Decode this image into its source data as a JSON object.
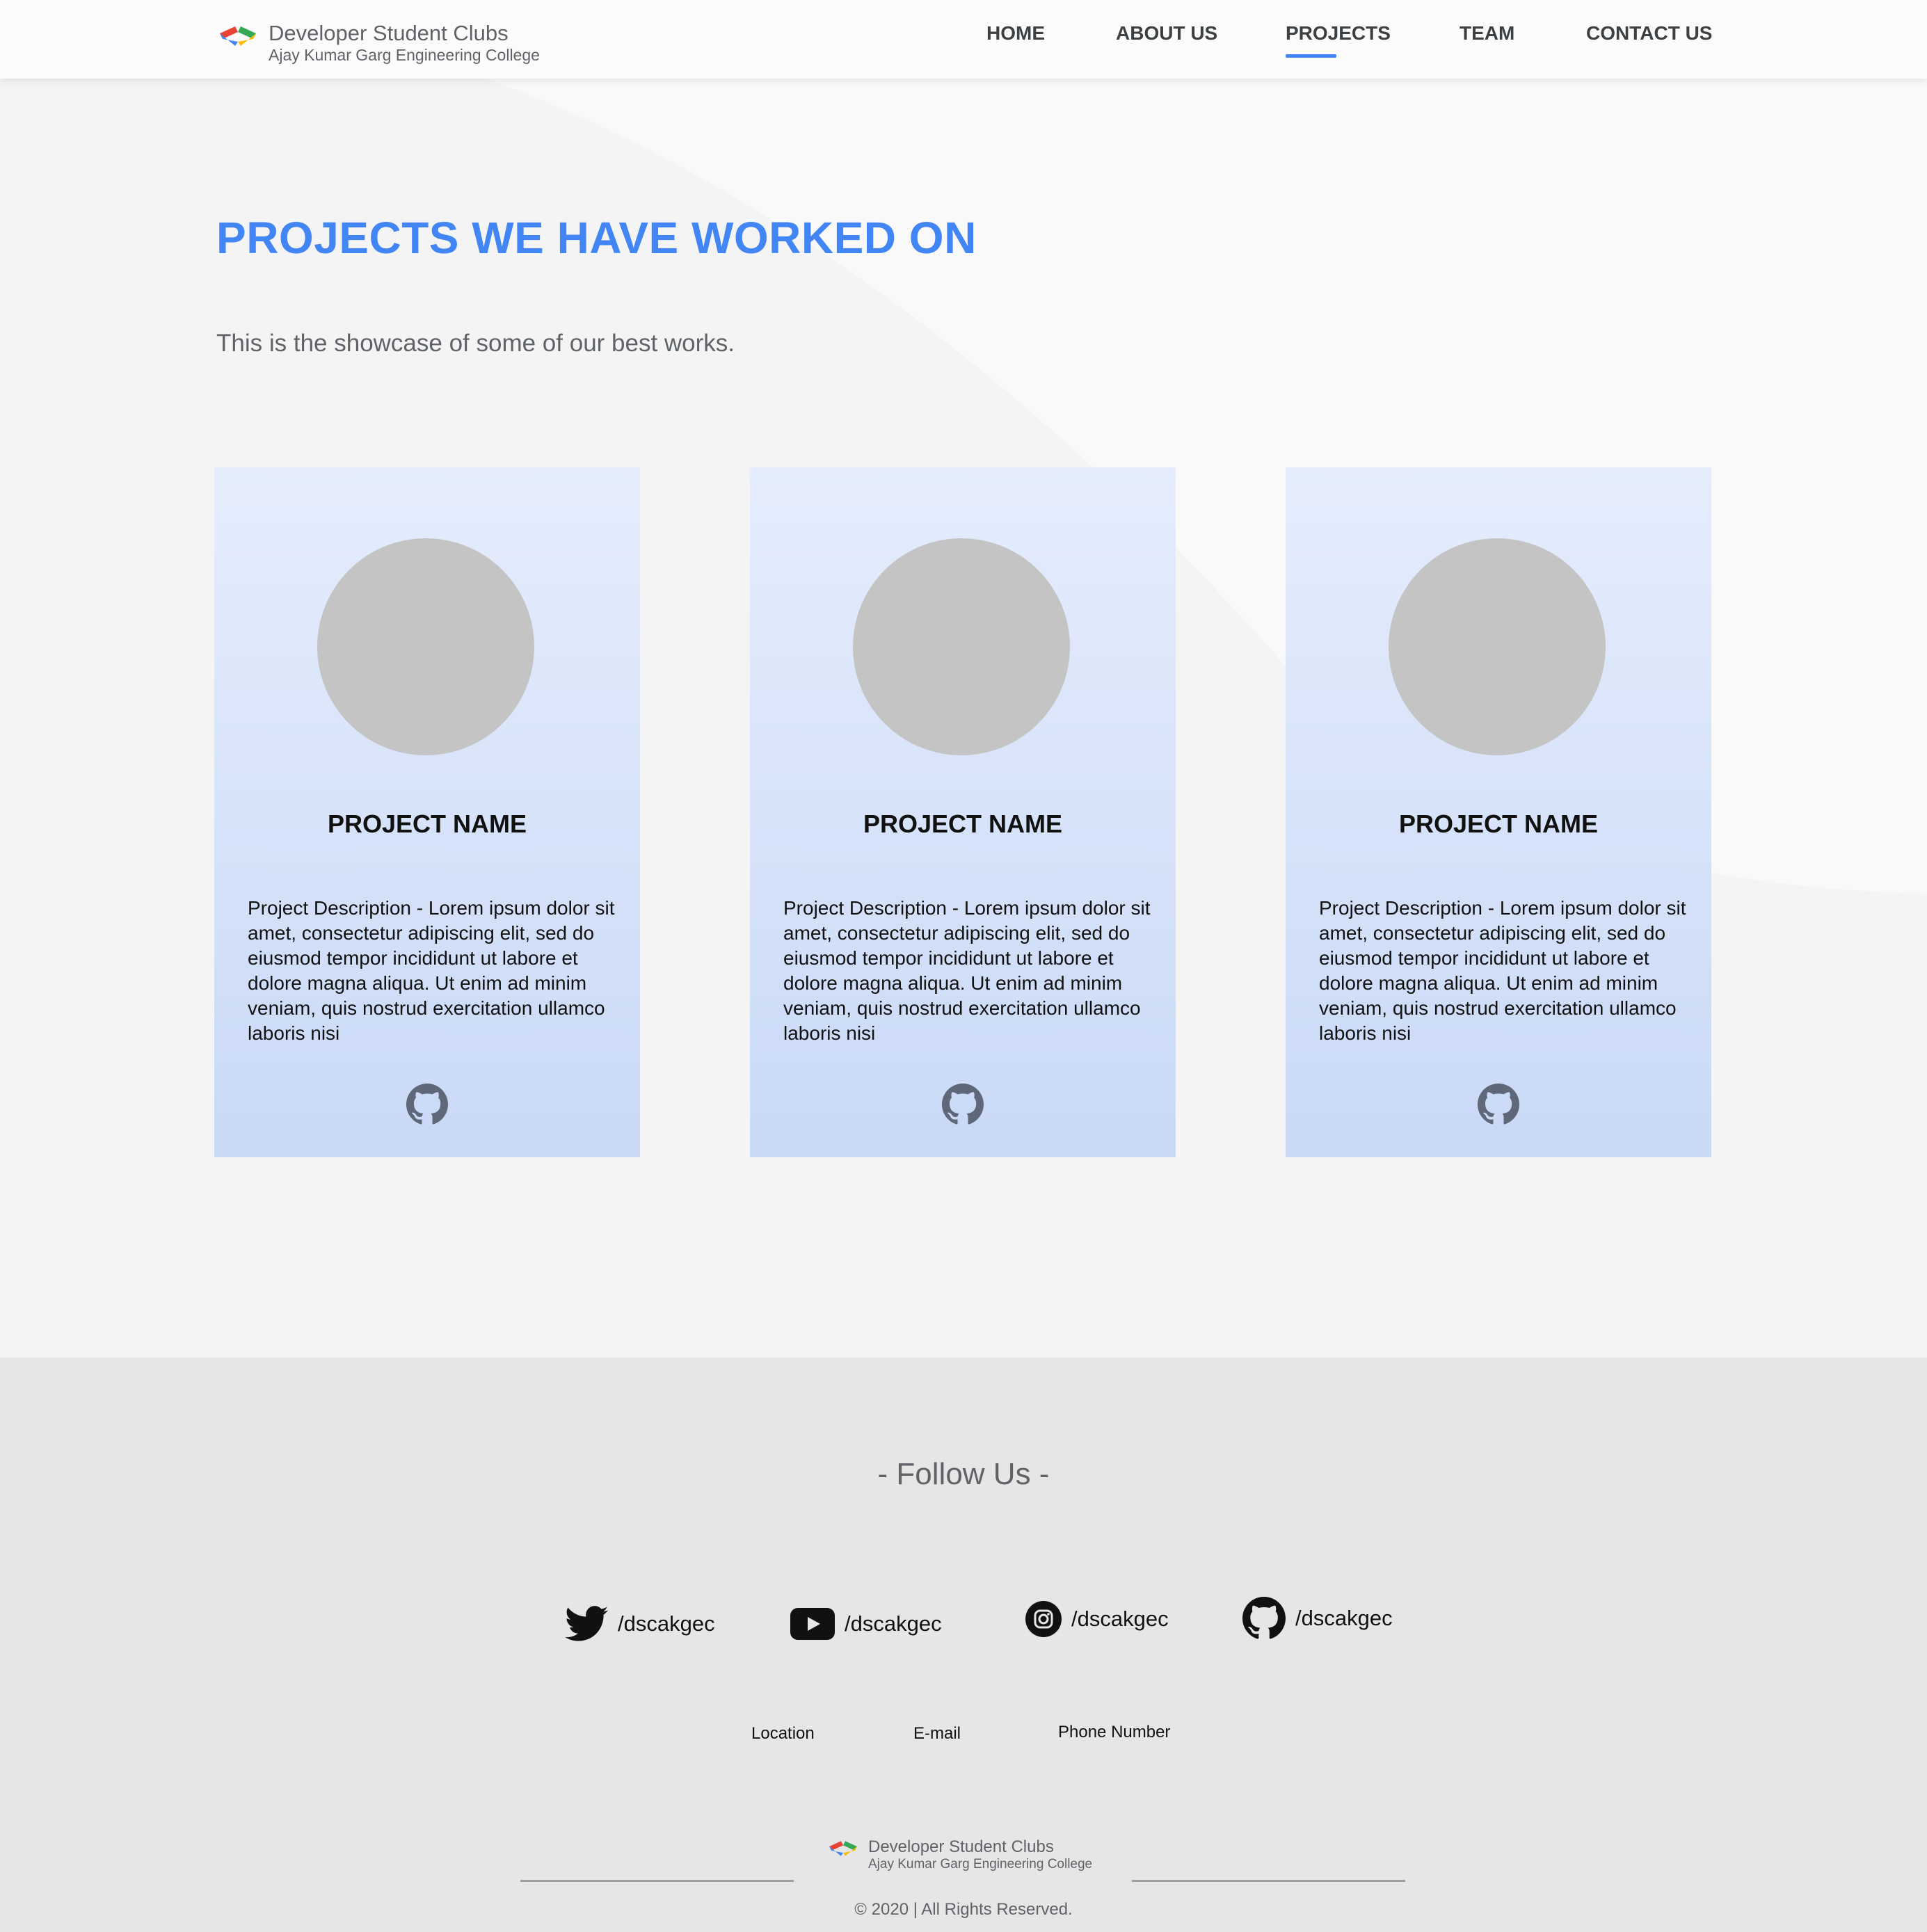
{
  "nav": {
    "brand_title": "Developer Student Clubs",
    "brand_subtitle": "Ajay Kumar Garg Engineering College",
    "items": [
      {
        "label": "HOME"
      },
      {
        "label": "ABOUT US"
      },
      {
        "label": "PROJECTS",
        "active": true
      },
      {
        "label": "TEAM"
      },
      {
        "label": "CONTACT US"
      }
    ]
  },
  "hero": {
    "title": "PROJECTS WE HAVE WORKED ON",
    "subtitle": "This is the showcase of some of our best works."
  },
  "projects": [
    {
      "name": "PROJECT NAME",
      "description": "Project Description - Lorem ipsum dolor sit amet, consectetur adipiscing elit, sed do eiusmod tempor incididunt ut labore et dolore magna aliqua. Ut enim ad minim veniam, quis nostrud exercitation ullamco laboris nisi",
      "icon": "github-icon"
    },
    {
      "name": "PROJECT NAME",
      "description": "Project Description - Lorem ipsum dolor sit amet, consectetur adipiscing elit, sed do eiusmod tempor incididunt ut labore et dolore magna aliqua. Ut enim ad minim veniam, quis nostrud exercitation ullamco laboris nisi",
      "icon": "github-icon"
    },
    {
      "name": "PROJECT NAME",
      "description": "Project Description - Lorem ipsum dolor sit amet, consectetur adipiscing elit, sed do eiusmod tempor incididunt ut labore et dolore magna aliqua. Ut enim ad minim veniam, quis nostrud exercitation ullamco laboris nisi",
      "icon": "github-icon"
    }
  ],
  "footer": {
    "follow_title": "- Follow Us -",
    "socials": [
      {
        "icon": "twitter-icon",
        "handle": "/dscakgec"
      },
      {
        "icon": "youtube-icon",
        "handle": "/dscakgec"
      },
      {
        "icon": "instagram-icon",
        "handle": "/dscakgec"
      },
      {
        "icon": "github-icon",
        "handle": "/dscakgec"
      }
    ],
    "contacts": [
      "Location",
      "E-mail",
      "Phone Number"
    ],
    "brand_title": "Developer Student Clubs",
    "brand_subtitle": "Ajay Kumar Garg Engineering College",
    "copyright": "© 2020 | All Rights Reserved."
  },
  "colors": {
    "accent": "#4285f4",
    "logo_red": "#ea4335",
    "logo_blue": "#4285f4",
    "logo_green": "#34a853",
    "logo_yellow": "#fbbc04",
    "card_top": "#e5edfc",
    "card_bottom": "#c9d9f6",
    "footer_bg": "#e6e6e6"
  }
}
